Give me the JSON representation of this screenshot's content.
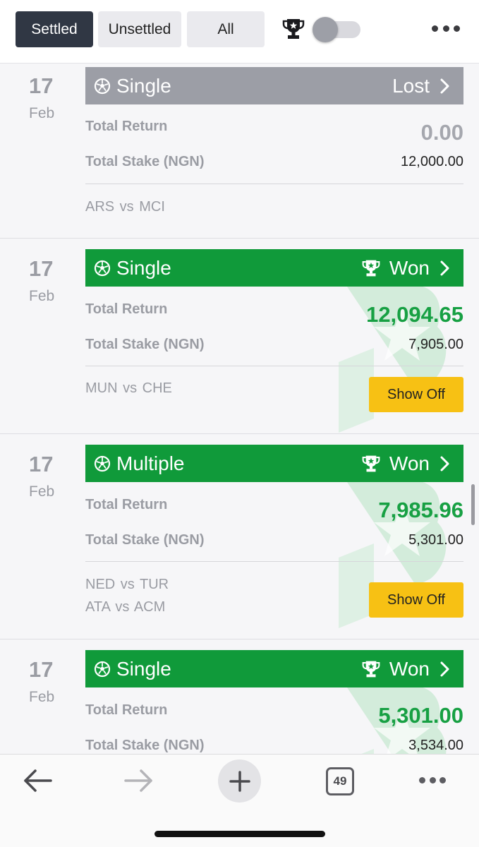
{
  "tabs": {
    "settled": "Settled",
    "unsettled": "Unsettled",
    "all": "All"
  },
  "labels": {
    "total_return": "Total Return",
    "total_stake": "Total Stake (NGN)",
    "show_off": "Show Off"
  },
  "colors": {
    "won": "#109a3a",
    "lost": "#9c9ea6",
    "show_off": "#f7c114",
    "active_tab": "#303744"
  },
  "bets": [
    {
      "day": "17",
      "month": "Feb",
      "type": "Single",
      "status": "Lost",
      "total_return": "0.00",
      "total_stake": "12,000.00",
      "matches": [
        "ARS  vs  MCI"
      ]
    },
    {
      "day": "17",
      "month": "Feb",
      "type": "Single",
      "status": "Won",
      "total_return": "12,094.65",
      "total_stake": "7,905.00",
      "matches": [
        "MUN vs CHE"
      ]
    },
    {
      "day": "17",
      "month": "Feb",
      "type": "Multiple",
      "status": "Won",
      "total_return": "7,985.96",
      "total_stake": "5,301.00",
      "matches": [
        "NED vs TUR",
        "ATA  vs  ACM"
      ]
    },
    {
      "day": "17",
      "month": "Feb",
      "type": "Single",
      "status": "Won",
      "total_return": "5,301.00",
      "total_stake": "3,534.00",
      "matches": []
    }
  ],
  "browser": {
    "tab_count": "49"
  }
}
